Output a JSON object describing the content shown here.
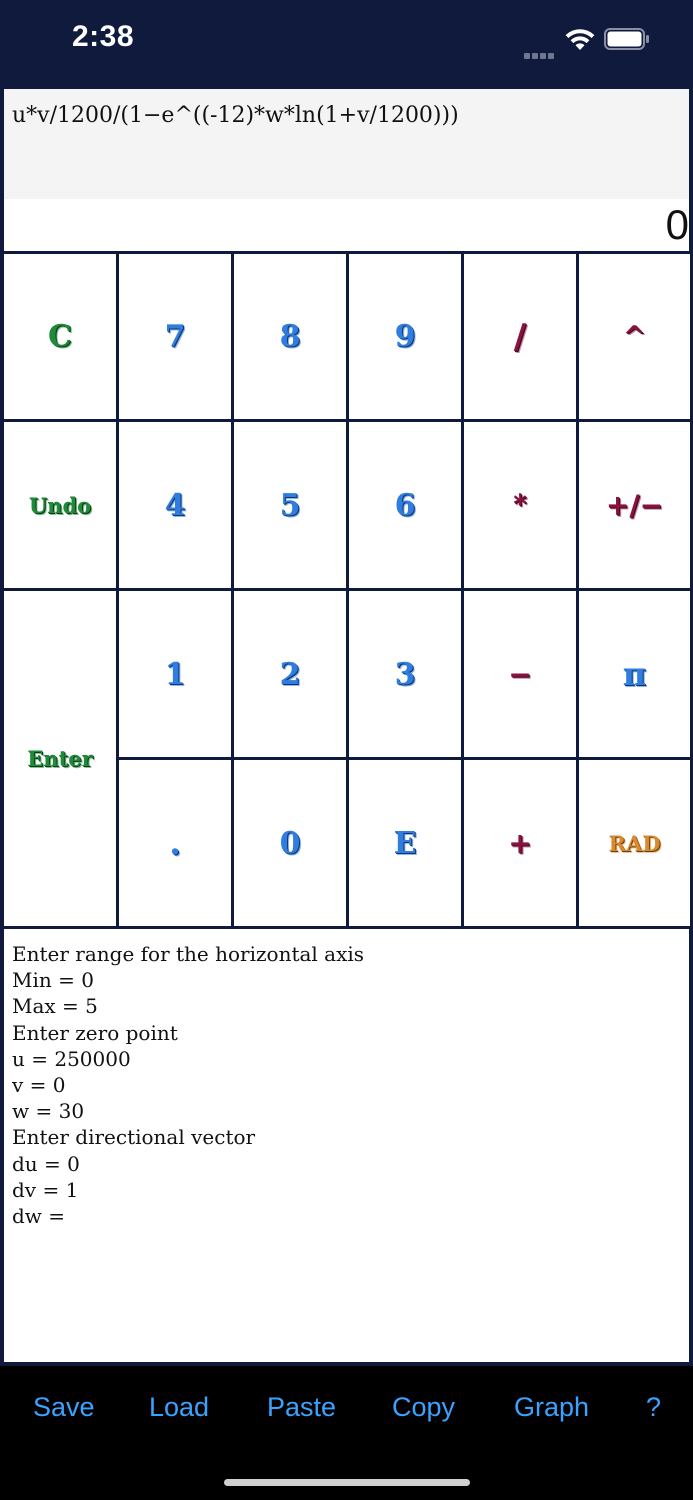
{
  "status_bar": {
    "time": "2:38",
    "icons": [
      "cellular-signal-icon",
      "wifi-icon",
      "battery-icon"
    ]
  },
  "display": {
    "expression": "u*v/1200/(1−e^((-12)*w*ln(1+v/1200)))",
    "result": "0"
  },
  "keys": {
    "clear": "C",
    "seven": "7",
    "eight": "8",
    "nine": "9",
    "divide": "/",
    "power": "^",
    "undo": "Undo",
    "four": "4",
    "five": "5",
    "six": "6",
    "multiply": "*",
    "negate": "+/−",
    "enter": "Enter",
    "one": "1",
    "two": "2",
    "three": "3",
    "minus": "−",
    "pi": "π",
    "decimal": ".",
    "zero": "0",
    "exponent": "E",
    "plus": "+",
    "angle_mode": "RAD"
  },
  "log": {
    "lines": [
      "Enter range for the horizontal axis",
      "Min = 0",
      "Max = 5",
      "Enter zero point",
      "u = 250000",
      "v = 0",
      "w = 30",
      "Enter directional vector",
      "du = 0",
      "dv = 1",
      "dw ="
    ]
  },
  "toolbar": {
    "save": "Save",
    "load": "Load",
    "paste": "Paste",
    "copy": "Copy",
    "graph": "Graph",
    "help": "?"
  },
  "colors": {
    "frame": "#0f1a3d",
    "key_green": "#1e8a3a",
    "key_blue": "#2f7de0",
    "key_maroon": "#8a1240",
    "key_orange": "#d9892e",
    "toolbar_text": "#3aa2ff"
  }
}
